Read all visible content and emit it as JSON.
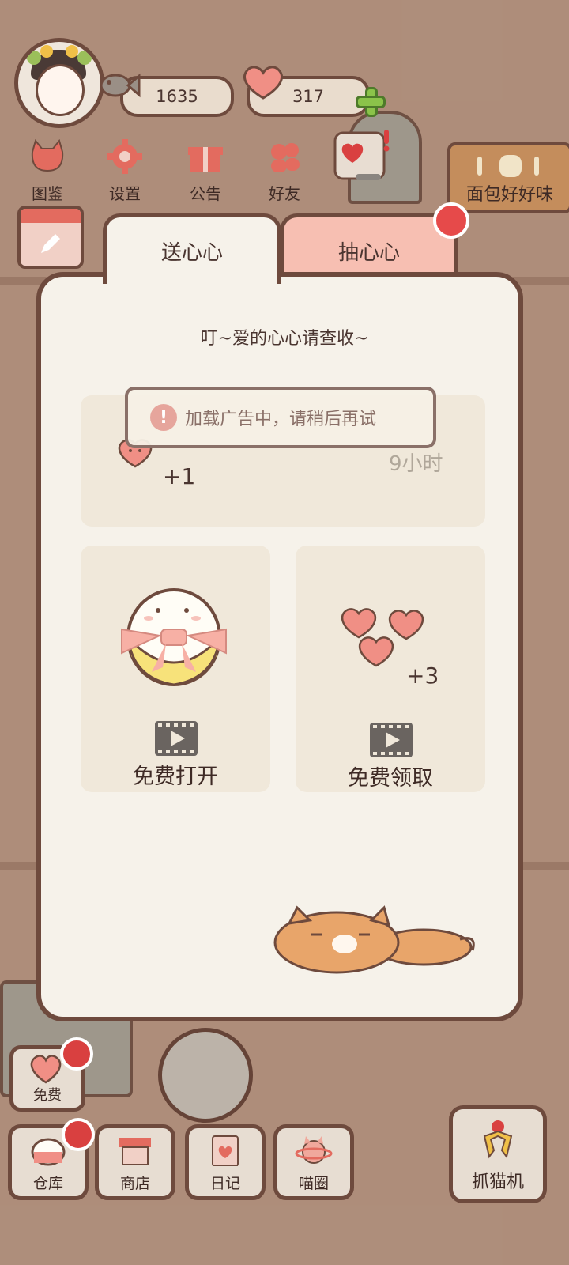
{
  "hud": {
    "fish_count": "1635",
    "heart_count": "317"
  },
  "menu": [
    {
      "label": "图鉴",
      "icon": "cat-book-icon"
    },
    {
      "label": "设置",
      "icon": "gear-icon"
    },
    {
      "label": "公告",
      "icon": "gift-icon"
    },
    {
      "label": "好友",
      "icon": "friends-icon"
    }
  ],
  "sign": {
    "label": "面包好好味"
  },
  "tabs": {
    "send": "送心心",
    "draw": "抽心心"
  },
  "panel": {
    "subtitle": "叮~爱的心心请查收~",
    "top_card": {
      "reward": "+1",
      "timer": "9小时"
    },
    "left_card": {
      "action": "免费打开"
    },
    "right_card": {
      "reward": "+3",
      "action": "免费领取"
    }
  },
  "toast": {
    "message": "加载广告中，请稍后再试"
  },
  "bottom": {
    "free": "免费",
    "warehouse": "仓库",
    "shop": "商店",
    "diary": "日记",
    "circle": "喵圈",
    "claw": "抓猫机"
  },
  "colors": {
    "outline": "#6e4a3d",
    "panel_bg": "#f6f2ea",
    "card_bg": "#f0e8da",
    "tab_active": "#f6f2ea",
    "tab_inactive": "#f7bfb2",
    "badge_red": "#e64a4a",
    "heart_pink": "#f08f85"
  }
}
